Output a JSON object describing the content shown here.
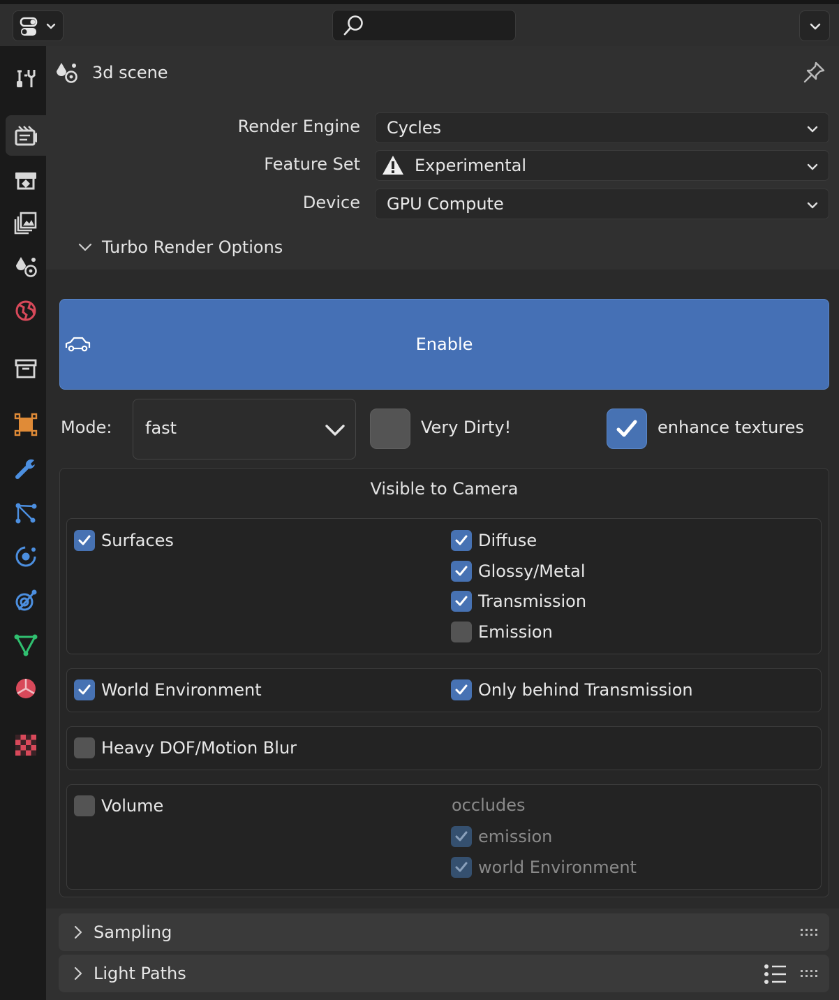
{
  "header": {
    "editor_type_icon": "properties-editor-icon",
    "search_icon": "search-icon",
    "search_placeholder": ""
  },
  "context": {
    "title": "3d scene"
  },
  "render": {
    "engine_label": "Render Engine",
    "engine_value": "Cycles",
    "feature_set_label": "Feature Set",
    "feature_set_value": "Experimental",
    "device_label": "Device",
    "device_value": "GPU Compute"
  },
  "turbo": {
    "section_title": "Turbo Render Options",
    "enable_label": "Enable",
    "mode_label": "Mode:",
    "mode_value": "fast",
    "very_dirty_label": "Very Dirty!",
    "very_dirty_checked": false,
    "enhance_label": "enhance textures",
    "enhance_checked": true,
    "visible_title": "Visible to Camera",
    "surfaces": {
      "label": "Surfaces",
      "checked": true
    },
    "diffuse": {
      "label": "Diffuse",
      "checked": true
    },
    "glossy": {
      "label": "Glossy/Metal",
      "checked": true
    },
    "transmission": {
      "label": "Transmission",
      "checked": true
    },
    "emission": {
      "label": "Emission",
      "checked": false
    },
    "world_env": {
      "label": "World Environment",
      "checked": true
    },
    "only_behind": {
      "label": "Only behind Transmission",
      "checked": true
    },
    "heavy_dof": {
      "label": "Heavy DOF/Motion Blur",
      "checked": false
    },
    "volume": {
      "label": "Volume",
      "checked": false
    },
    "occludes_label": "occludes",
    "occ_emission": {
      "label": "emission",
      "checked": true
    },
    "occ_world": {
      "label": "world Environment",
      "checked": true
    }
  },
  "sections": {
    "sampling": "Sampling",
    "light_paths": "Light Paths"
  },
  "colors": {
    "accent": "#4772b3",
    "enable_button": "#4570b5",
    "panel_bg": "#303030",
    "subpanel_bg": "#2a2a2a"
  }
}
